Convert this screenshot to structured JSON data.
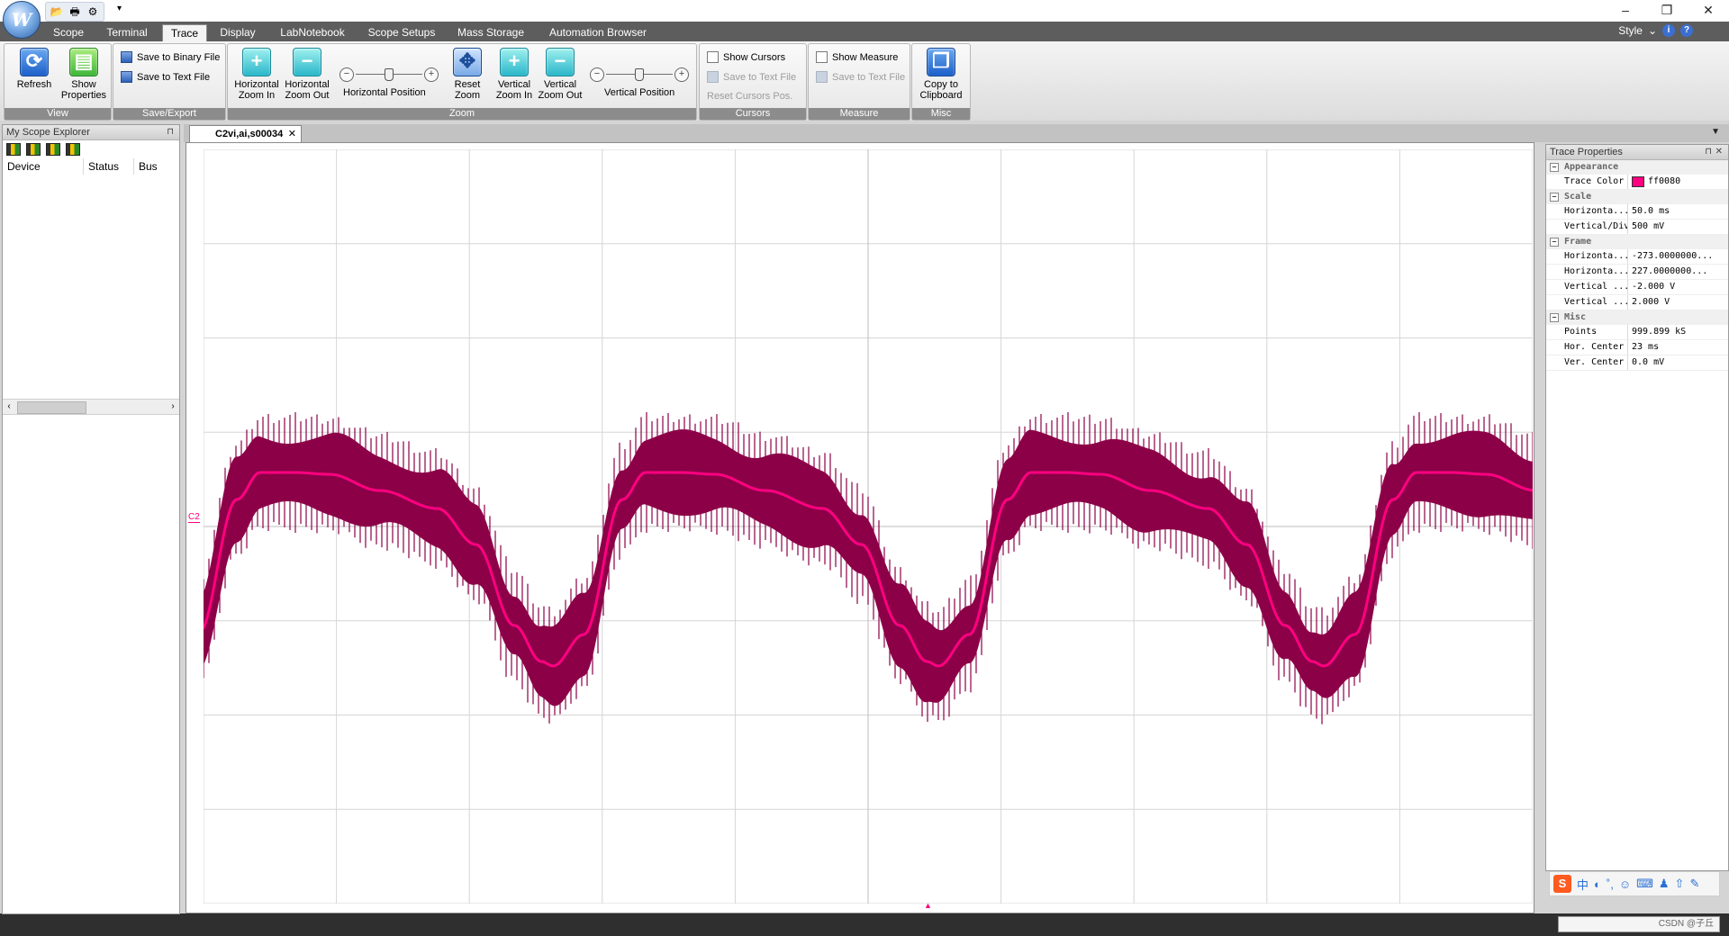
{
  "window": {
    "minimize": "–",
    "restore": "❐",
    "close": "✕"
  },
  "app": {
    "orb_letter": "W"
  },
  "quick_access": {
    "icons": [
      "open-folder-icon",
      "print-icon",
      "settings-icon"
    ]
  },
  "tabs": [
    "Scope",
    "Terminal",
    "Trace",
    "Display",
    "LabNotebook",
    "Scope Setups",
    "Mass Storage",
    "Automation Browser"
  ],
  "active_tab": "Trace",
  "style_menu": {
    "label": "Style",
    "help": "i",
    "about": "?"
  },
  "ribbon": {
    "view": {
      "label": "View",
      "refresh": "Refresh",
      "show_properties": "Show Properties"
    },
    "save_export": {
      "label": "Save/Export",
      "save_binary": "Save to Binary File",
      "save_text": "Save to Text File"
    },
    "zoom": {
      "label": "Zoom",
      "h_zoom_in": "Horizontal Zoom In",
      "h_zoom_out": "Horizontal Zoom Out",
      "h_position": "Horizontal Position",
      "reset_zoom": "Reset Zoom",
      "v_zoom_in": "Vertical Zoom In",
      "v_zoom_out": "Vertical Zoom Out",
      "v_position": "Vertical Position"
    },
    "cursors": {
      "label": "Cursors",
      "show_cursors": "Show Cursors",
      "save_text": "Save to Text File",
      "reset_pos": "Reset Cursors Pos."
    },
    "measure": {
      "label": "Measure",
      "show_measure": "Show Measure",
      "save_text": "Save to Text File"
    },
    "misc": {
      "label": "Misc",
      "copy_clipboard": "Copy to Clipboard"
    }
  },
  "explorer": {
    "title": "My Scope Explorer",
    "columns": [
      "Device",
      "Status",
      "Bus"
    ]
  },
  "document": {
    "tab_title": "C2vi,ai,s00034",
    "channel_label": "C2"
  },
  "trace": {
    "color": "#ff0080",
    "envelope_color": "#8c0048"
  },
  "properties": {
    "title": "Trace Properties",
    "categories": [
      {
        "name": "Appearance",
        "rows": [
          {
            "key": "Trace Color",
            "value": "ff0080"
          }
        ]
      },
      {
        "name": "Scale",
        "rows": [
          {
            "key": "Horizonta...",
            "value": "50.0 ms"
          },
          {
            "key": "Vertical/Div",
            "value": "500 mV"
          }
        ]
      },
      {
        "name": "Frame",
        "rows": [
          {
            "key": "Horizonta...",
            "value": "-273.0000000..."
          },
          {
            "key": "Horizonta...",
            "value": "227.0000000..."
          },
          {
            "key": "Vertical ...",
            "value": "-2.000 V"
          },
          {
            "key": "Vertical ...",
            "value": "2.000 V"
          }
        ]
      },
      {
        "name": "Misc",
        "rows": [
          {
            "key": "Points",
            "value": "999.899 kS"
          },
          {
            "key": "Hor. Center",
            "value": "23 ms"
          },
          {
            "key": "Ver. Center",
            "value": "0.0 mV"
          }
        ]
      }
    ]
  },
  "ime": {
    "logo": "S",
    "glyphs": [
      "中",
      "◐",
      "˚,",
      "☺",
      "⌨",
      "♟",
      "⇧",
      "✎"
    ]
  },
  "status": {
    "watermark": "CSDN @子丘"
  }
}
